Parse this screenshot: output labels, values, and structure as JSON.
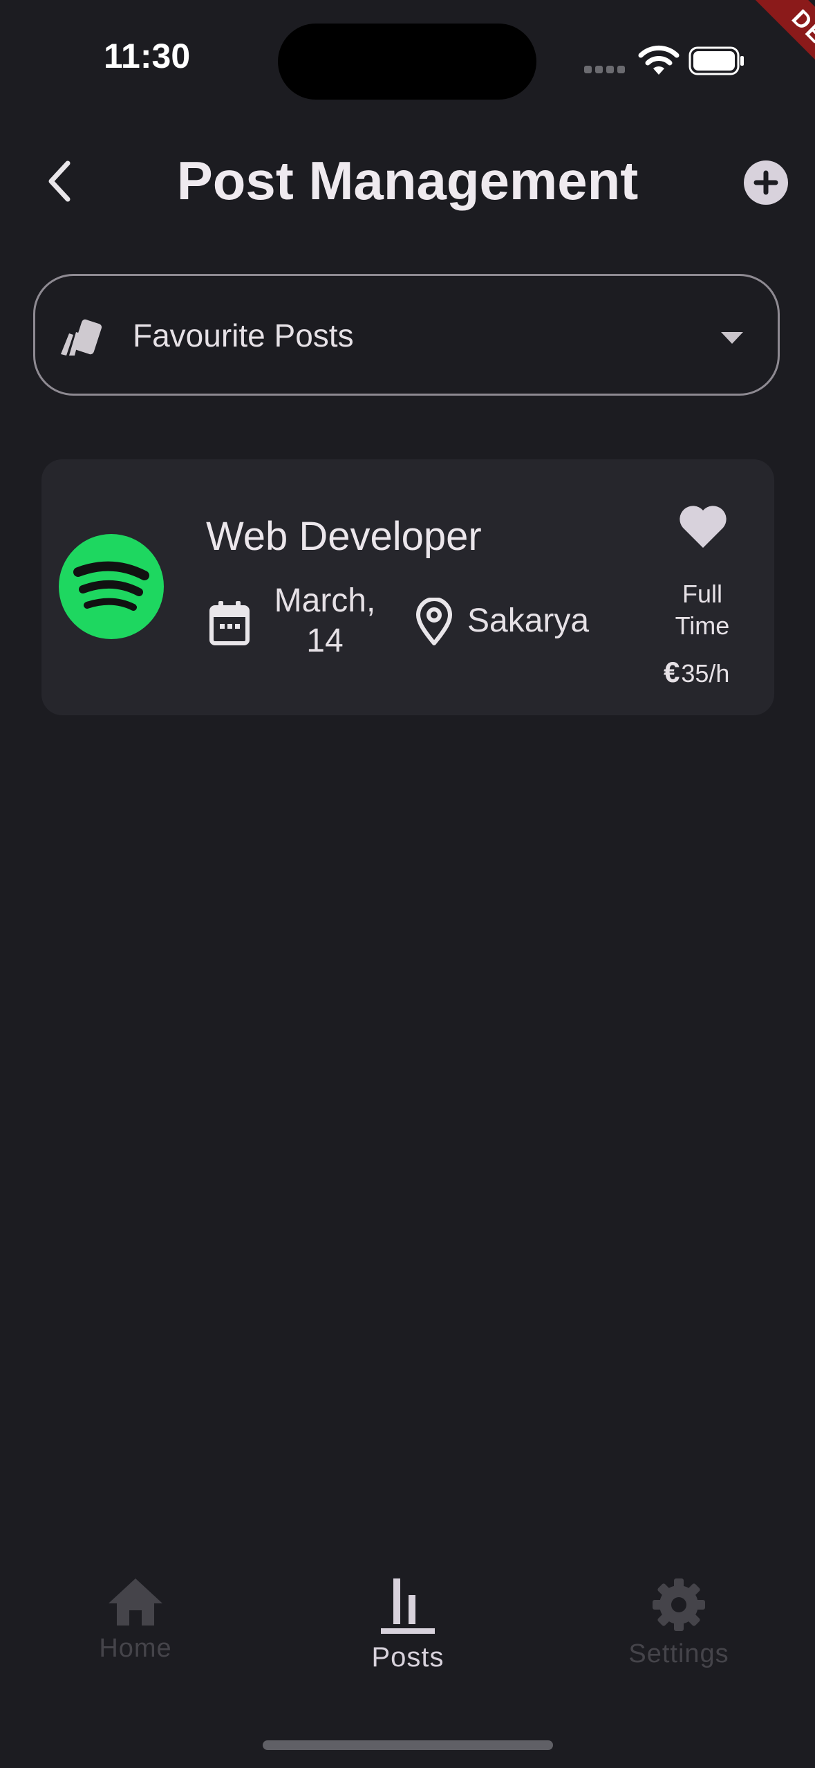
{
  "status_bar": {
    "time": "11:30",
    "debug_label": "DEBUG"
  },
  "header": {
    "title": "Post Management",
    "back_icon": "chevron-left-icon",
    "add_icon": "plus-circle-icon"
  },
  "filter": {
    "selected": "Favourite Posts",
    "icon": "cards-icon"
  },
  "posts": [
    {
      "title": "Web Developer",
      "company_logo": "spotify-logo",
      "date_line1": "March,",
      "date_line2": "14",
      "location": "Sakarya",
      "job_type_line1": "Full",
      "job_type_line2": "Time",
      "currency": "€",
      "rate": "35/h",
      "favorite": true
    }
  ],
  "bottom_nav": {
    "items": [
      {
        "label": "Home",
        "icon": "home-icon",
        "active": false
      },
      {
        "label": "Posts",
        "icon": "posts-icon",
        "active": true
      },
      {
        "label": "Settings",
        "icon": "gear-icon",
        "active": false
      }
    ]
  },
  "colors": {
    "background": "#1c1c21",
    "card": "#26262c",
    "accent": "#d8d2dc",
    "spotify_green": "#1ed760",
    "debug_red": "#8b1a1a"
  }
}
